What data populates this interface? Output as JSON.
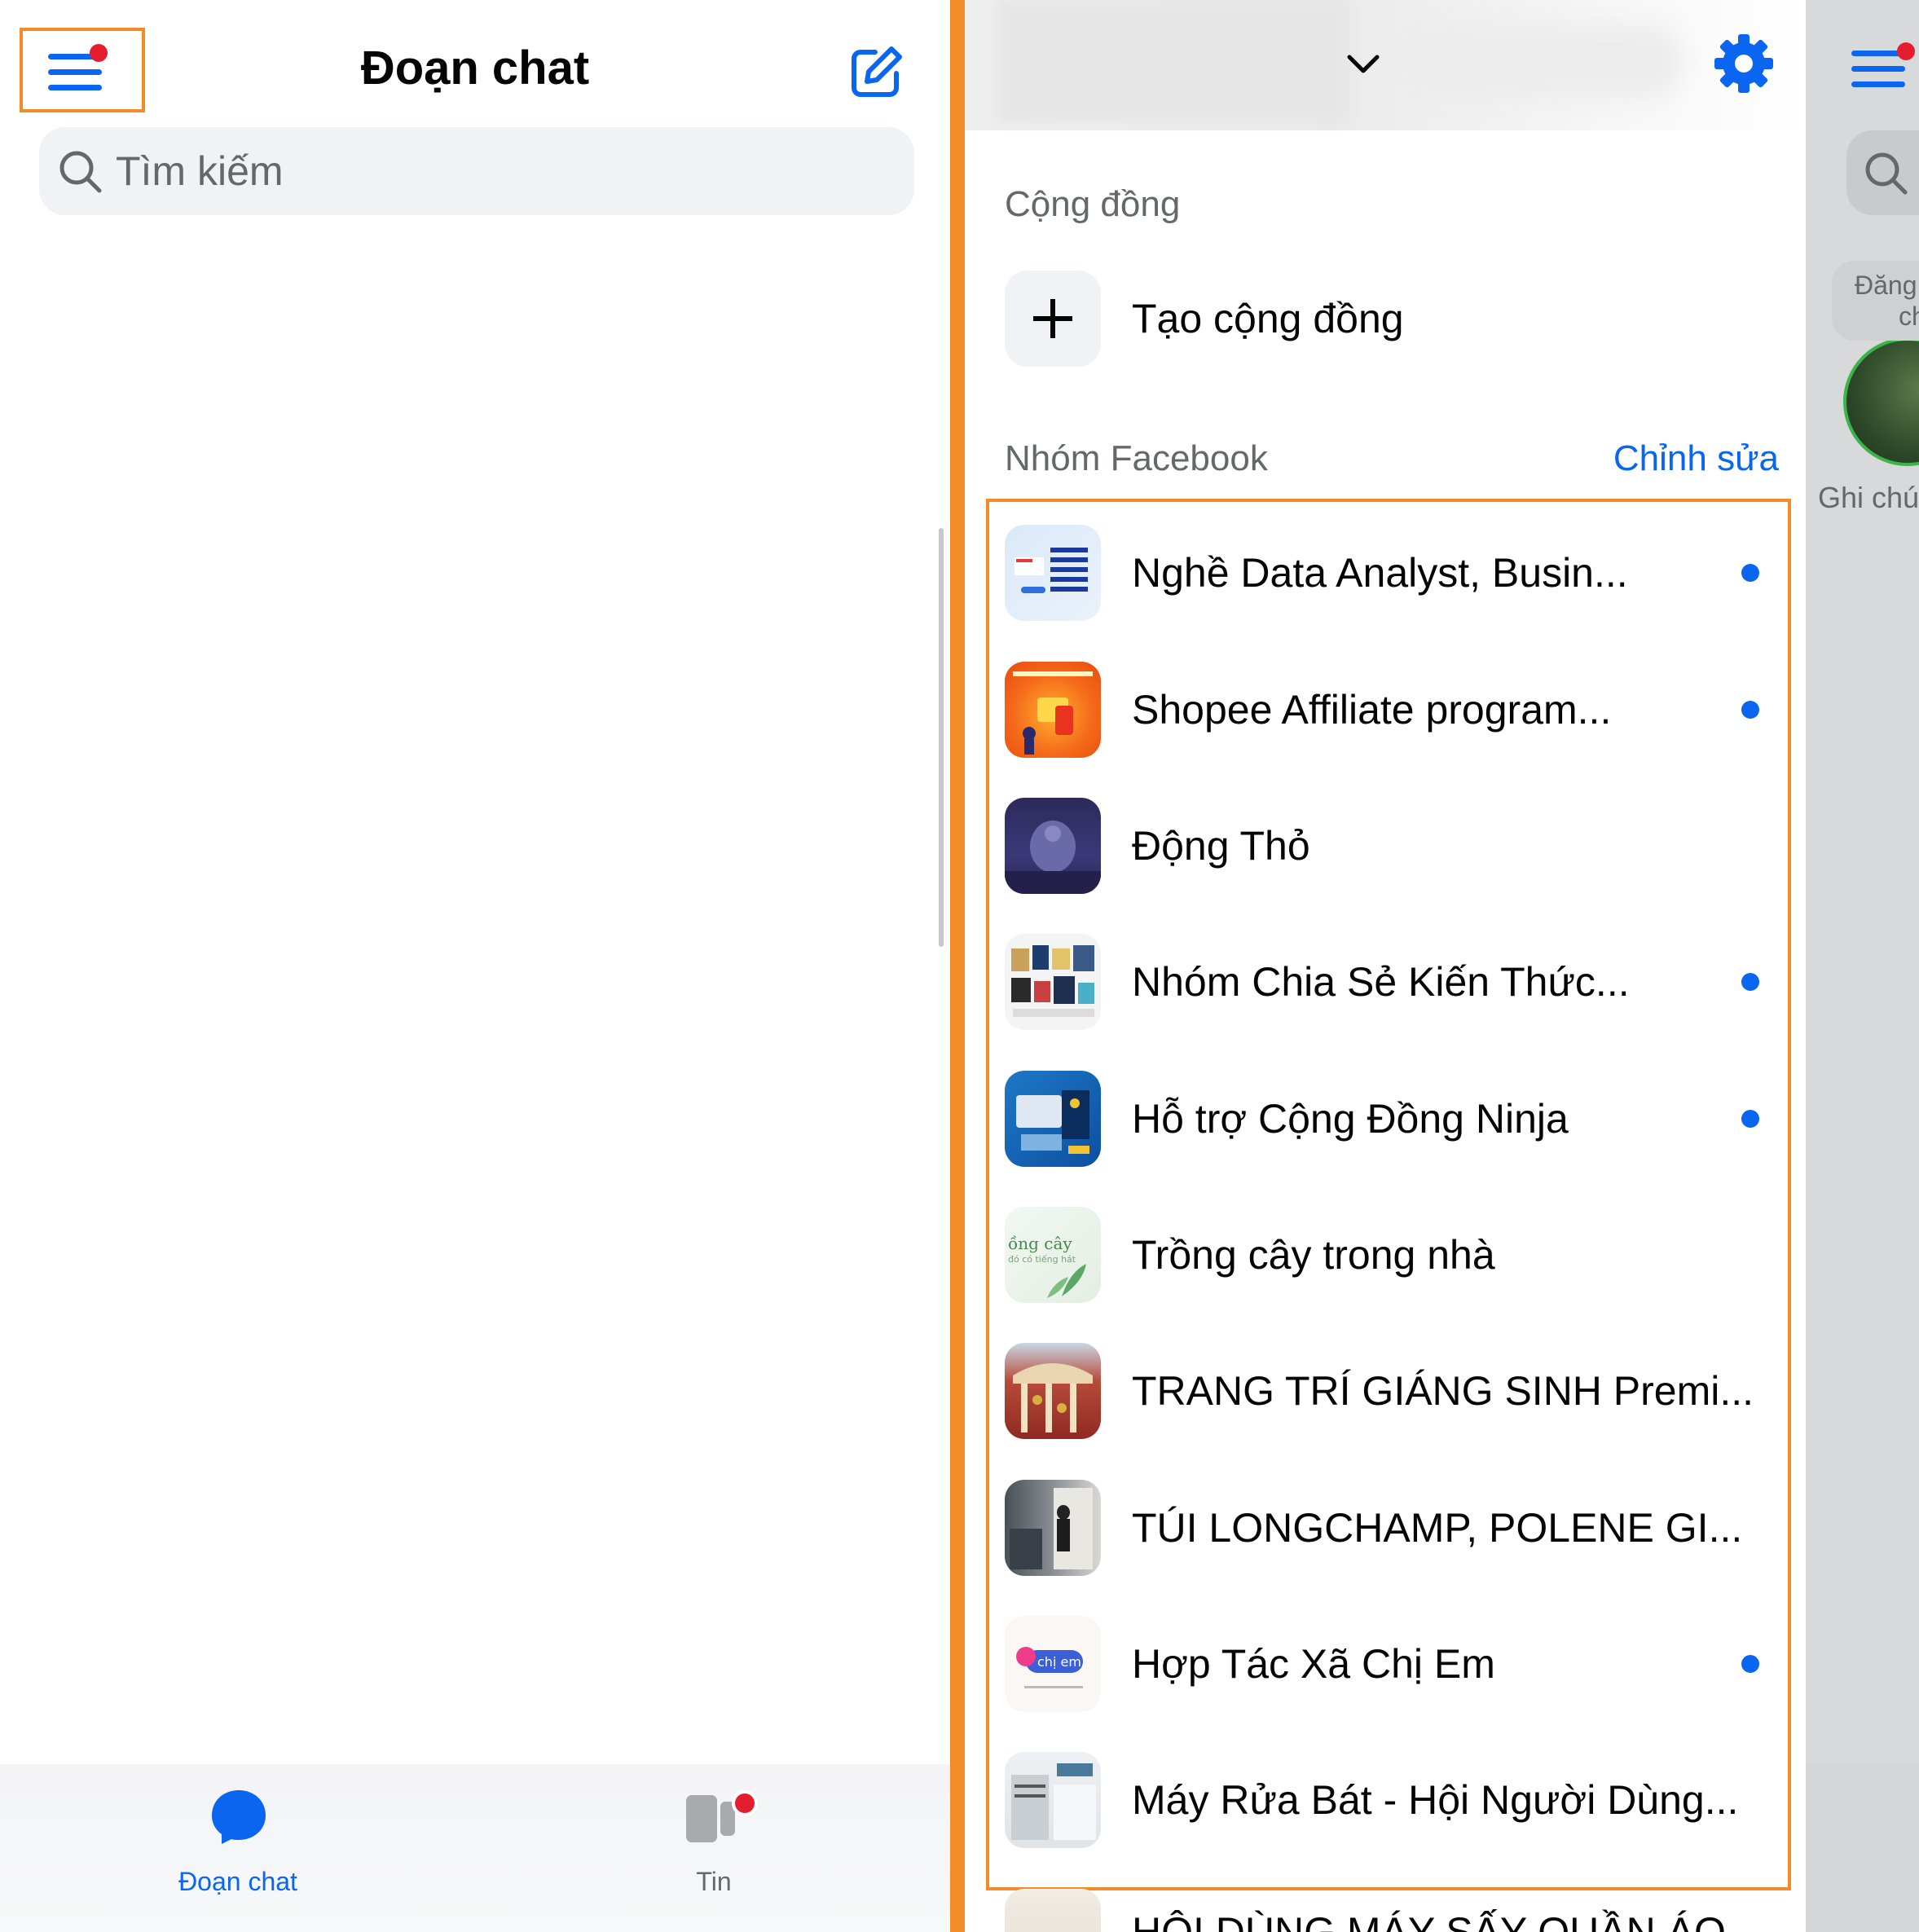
{
  "header": {
    "title": "Đoạn chat",
    "search_placeholder": "Tìm kiếm"
  },
  "tabbar": {
    "chats_label": "Đoạn chat",
    "stories_label": "Tin"
  },
  "drawer": {
    "community_section": "Cộng đồng",
    "create_community": "Tạo cộng đồng",
    "groups_section": "Nhóm Facebook",
    "edit_label": "Chỉnh sửa",
    "groups": [
      {
        "name": "Nghề Data Analyst, Busin...",
        "unread": true,
        "avatar": "data-analyst-avatar"
      },
      {
        "name": "Shopee Affiliate program...",
        "unread": true,
        "avatar": "shopee-affiliate-avatar"
      },
      {
        "name": "Động Thỏ",
        "unread": false,
        "avatar": "dong-tho-avatar"
      },
      {
        "name": "Nhóm Chia Sẻ Kiến Thức...",
        "unread": true,
        "avatar": "chia-se-kien-thuc-avatar"
      },
      {
        "name": "Hỗ trợ Cộng Đồng Ninja",
        "unread": true,
        "avatar": "ninja-avatar"
      },
      {
        "name": "Trồng cây trong nhà",
        "unread": false,
        "avatar": "trong-cay-avatar"
      },
      {
        "name": "TRANG TRÍ GIÁNG SINH Premi...",
        "unread": false,
        "avatar": "giang-sinh-avatar"
      },
      {
        "name": "TÚI LONGCHAMP, POLENE GI...",
        "unread": false,
        "avatar": "longchamp-avatar"
      },
      {
        "name": "Hợp Tác Xã Chị Em",
        "unread": true,
        "avatar": "hop-tac-xa-avatar"
      },
      {
        "name": "Máy Rửa Bát - Hội Người Dùng...",
        "unread": false,
        "avatar": "may-rua-bat-avatar"
      },
      {
        "name": "HỘI DÙNG MÁY SẤY QUẦN ÁO",
        "unread": false,
        "avatar": "may-say-avatar"
      }
    ]
  },
  "peek": {
    "note_bubble_line1": "Đăng",
    "note_bubble_line2": "chú",
    "note_label": "Ghi chú"
  },
  "colors": {
    "accent_blue": "#0a66f0",
    "highlight_orange": "#f28c28",
    "notification_red": "#e41e2f",
    "secondary_text": "#65676b"
  }
}
